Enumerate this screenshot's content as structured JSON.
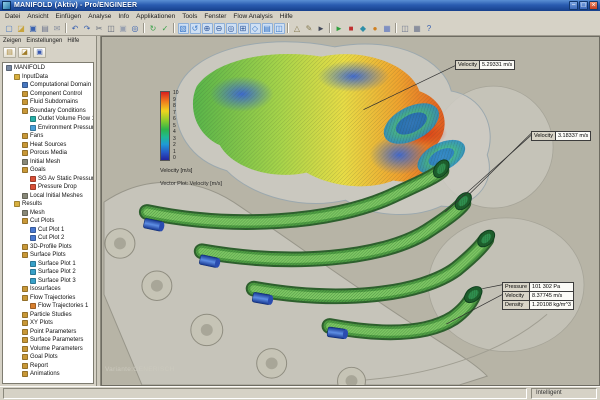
{
  "window": {
    "title": "MANIFOLD (Aktiv) - Pro/ENGINEER",
    "controls": [
      {
        "name": "minimize-button",
        "glyph": "−"
      },
      {
        "name": "maximize-button",
        "glyph": "□"
      },
      {
        "name": "close-button",
        "glyph": "×"
      }
    ]
  },
  "menu_bar": {
    "items": [
      "Datei",
      "Ansicht",
      "Einfügen",
      "Analyse",
      "Info",
      "Applikationen",
      "Tools",
      "Fenster",
      "Flow Analysis",
      "Hilfe"
    ]
  },
  "toolbar": {
    "groups": [
      [
        {
          "name": "new-file-icon",
          "glyph": "▢",
          "color": "#4a78c0"
        },
        {
          "name": "open-folder-icon",
          "glyph": "◪",
          "color": "#c8a43c"
        },
        {
          "name": "save-icon",
          "glyph": "▣",
          "color": "#3a62b0"
        },
        {
          "name": "print-icon",
          "glyph": "▤",
          "color": "#707890"
        },
        {
          "name": "mail-icon",
          "glyph": "✉",
          "color": "#8890a0"
        }
      ],
      [
        {
          "name": "undo-icon",
          "glyph": "↶",
          "color": "#3a62b0"
        },
        {
          "name": "redo-icon",
          "glyph": "↷",
          "color": "#3a62b0"
        },
        {
          "name": "cut-icon",
          "glyph": "✂",
          "color": "#606878"
        },
        {
          "name": "copy-icon",
          "glyph": "◫",
          "color": "#606878"
        },
        {
          "name": "paste-icon",
          "glyph": "▣",
          "color": "#98a0b0"
        },
        {
          "name": "search-icon",
          "glyph": "◎",
          "color": "#3a62b0"
        }
      ],
      [
        {
          "name": "regenerate-icon",
          "glyph": "↻",
          "color": "#38a048"
        },
        {
          "name": "verify-icon",
          "glyph": "✓",
          "color": "#38a048"
        }
      ],
      [
        {
          "name": "repaint-icon",
          "glyph": "▧",
          "color": "#3a78c8",
          "hl": true
        },
        {
          "name": "spin-icon",
          "glyph": "↺",
          "color": "#3a78c8",
          "hl": true
        },
        {
          "name": "zoom-in-icon",
          "glyph": "⊕",
          "color": "#30589c",
          "hl": true
        },
        {
          "name": "zoom-out-icon",
          "glyph": "⊖",
          "color": "#30589c",
          "hl": true
        },
        {
          "name": "refit-icon",
          "glyph": "◎",
          "color": "#30589c",
          "hl": true
        },
        {
          "name": "pan-icon",
          "glyph": "⊞",
          "color": "#30589c",
          "hl": true
        },
        {
          "name": "saved-views-icon",
          "glyph": "◇",
          "color": "#3a78c8",
          "hl": true
        },
        {
          "name": "layers-icon",
          "glyph": "▤",
          "color": "#3a78c8",
          "hl": true
        },
        {
          "name": "view-manager-icon",
          "glyph": "◫",
          "color": "#3a78c8",
          "hl": true
        }
      ],
      [
        {
          "name": "datum-plane-icon",
          "glyph": "△",
          "color": "#857a50"
        },
        {
          "name": "sketch-icon",
          "glyph": "✎",
          "color": "#857a50"
        },
        {
          "name": "select-arrow-icon",
          "glyph": "►",
          "color": "#42485a"
        }
      ],
      [
        {
          "name": "flow-run-icon",
          "glyph": "►",
          "color": "#2f9f3f"
        },
        {
          "name": "flow-stop-icon",
          "glyph": "■",
          "color": "#c03030"
        },
        {
          "name": "flow-results-icon",
          "glyph": "◆",
          "color": "#2f8fa8"
        },
        {
          "name": "flow-plot-icon",
          "glyph": "●",
          "color": "#d08020"
        },
        {
          "name": "flow-mesh-icon",
          "glyph": "▦",
          "color": "#6078c0"
        }
      ],
      [
        {
          "name": "window-cascade-icon",
          "glyph": "◫",
          "color": "#707890"
        },
        {
          "name": "window-tile-icon",
          "glyph": "▦",
          "color": "#707890"
        },
        {
          "name": "help-icon",
          "glyph": "?",
          "color": "#3a62b0"
        }
      ]
    ]
  },
  "navigator": {
    "menus": [
      "Zeigen",
      "Einstellungen",
      "Hilfe"
    ],
    "tool_icons": [
      {
        "name": "model-tree-tab-icon",
        "glyph": "▤",
        "color": "#a07c28"
      },
      {
        "name": "folder-browser-tab-icon",
        "glyph": "◪",
        "color": "#a07c28"
      },
      {
        "name": "display-settings-tab-icon",
        "glyph": "▣",
        "color": "#3858b0"
      }
    ],
    "tree": [
      {
        "label": "MANIFOLD",
        "depth": 0,
        "icon_color": "#7888a0"
      },
      {
        "label": "InputData",
        "depth": 1,
        "icon_color": "#d8b040"
      },
      {
        "label": "Computational Domain",
        "depth": 2,
        "icon_color": "#4878c0"
      },
      {
        "label": "Component Control",
        "depth": 2,
        "icon_color": "#c89838"
      },
      {
        "label": "Fluid Subdomains",
        "depth": 2,
        "icon_color": "#c89838"
      },
      {
        "label": "Boundary Conditions",
        "depth": 2,
        "icon_color": "#c89838"
      },
      {
        "label": "Outlet Volume Flow 1",
        "depth": 3,
        "icon_color": "#28b0a8"
      },
      {
        "label": "Environment Pressure 1",
        "depth": 3,
        "icon_color": "#48a0d8"
      },
      {
        "label": "Fans",
        "depth": 2,
        "icon_color": "#c89838"
      },
      {
        "label": "Heat Sources",
        "depth": 2,
        "icon_color": "#c89838"
      },
      {
        "label": "Porous Media",
        "depth": 2,
        "icon_color": "#c89838"
      },
      {
        "label": "Initial Mesh",
        "depth": 2,
        "icon_color": "#888878"
      },
      {
        "label": "Goals",
        "depth": 2,
        "icon_color": "#c89838"
      },
      {
        "label": "SG Av Static Pressure 1",
        "depth": 3,
        "icon_color": "#d85038"
      },
      {
        "label": "Pressure Drop",
        "depth": 3,
        "icon_color": "#d85038"
      },
      {
        "label": "Local Initial Meshes",
        "depth": 2,
        "icon_color": "#888878"
      },
      {
        "label": "Results",
        "depth": 1,
        "icon_color": "#d8b040"
      },
      {
        "label": "Mesh",
        "depth": 2,
        "icon_color": "#888878"
      },
      {
        "label": "Cut Plots",
        "depth": 2,
        "icon_color": "#c89838"
      },
      {
        "label": "Cut Plot 1",
        "depth": 3,
        "icon_color": "#4878d0"
      },
      {
        "label": "Cut Plot 2",
        "depth": 3,
        "icon_color": "#4878d0"
      },
      {
        "label": "3D-Profile Plots",
        "depth": 2,
        "icon_color": "#c89838"
      },
      {
        "label": "Surface Plots",
        "depth": 2,
        "icon_color": "#c89838"
      },
      {
        "label": "Surface Plot 1",
        "depth": 3,
        "icon_color": "#38a0c8"
      },
      {
        "label": "Surface Plot 2",
        "depth": 3,
        "icon_color": "#38a0c8"
      },
      {
        "label": "Surface Plot 3",
        "depth": 3,
        "icon_color": "#38a0c8"
      },
      {
        "label": "Isosurfaces",
        "depth": 2,
        "icon_color": "#c89838"
      },
      {
        "label": "Flow Trajectories",
        "depth": 2,
        "icon_color": "#c89838"
      },
      {
        "label": "Flow Trajectories 1",
        "depth": 3,
        "icon_color": "#d88030"
      },
      {
        "label": "Particle Studies",
        "depth": 2,
        "icon_color": "#c89838"
      },
      {
        "label": "XY Plots",
        "depth": 2,
        "icon_color": "#c89838"
      },
      {
        "label": "Point Parameters",
        "depth": 2,
        "icon_color": "#c89838"
      },
      {
        "label": "Surface Parameters",
        "depth": 2,
        "icon_color": "#c89838"
      },
      {
        "label": "Volume Parameters",
        "depth": 2,
        "icon_color": "#c89838"
      },
      {
        "label": "Goal Plots",
        "depth": 2,
        "icon_color": "#c89838"
      },
      {
        "label": "Report",
        "depth": 2,
        "icon_color": "#c89838"
      },
      {
        "label": "Animations",
        "depth": 2,
        "icon_color": "#c89838"
      }
    ]
  },
  "viewport": {
    "legend": {
      "ticks": [
        "10",
        "9",
        "8",
        "7",
        "6",
        "5",
        "4",
        "3",
        "2",
        "1",
        "0"
      ],
      "title": "Velocity [m/s]",
      "subtitle": "Vector Plot: Velocity [m/s]",
      "color_top": "#d81e1e",
      "color_bottom": "#24249e"
    },
    "watermark": "Variante:GENERISCH",
    "callouts": {
      "velocity_top": {
        "label": "Velocity",
        "value": "5.29331 m/s"
      },
      "velocity_mid": {
        "label": "Velocity",
        "value": "3.18337 m/s"
      },
      "params": {
        "rows": [
          {
            "label": "Pressure",
            "value": "101 302 Pa"
          },
          {
            "label": "Velocity",
            "value": "8.37745 m/s"
          },
          {
            "label": "Density",
            "value": "1.20108 kg/m^3"
          }
        ]
      }
    }
  },
  "status_bar": {
    "right_label": "Intelligent"
  }
}
